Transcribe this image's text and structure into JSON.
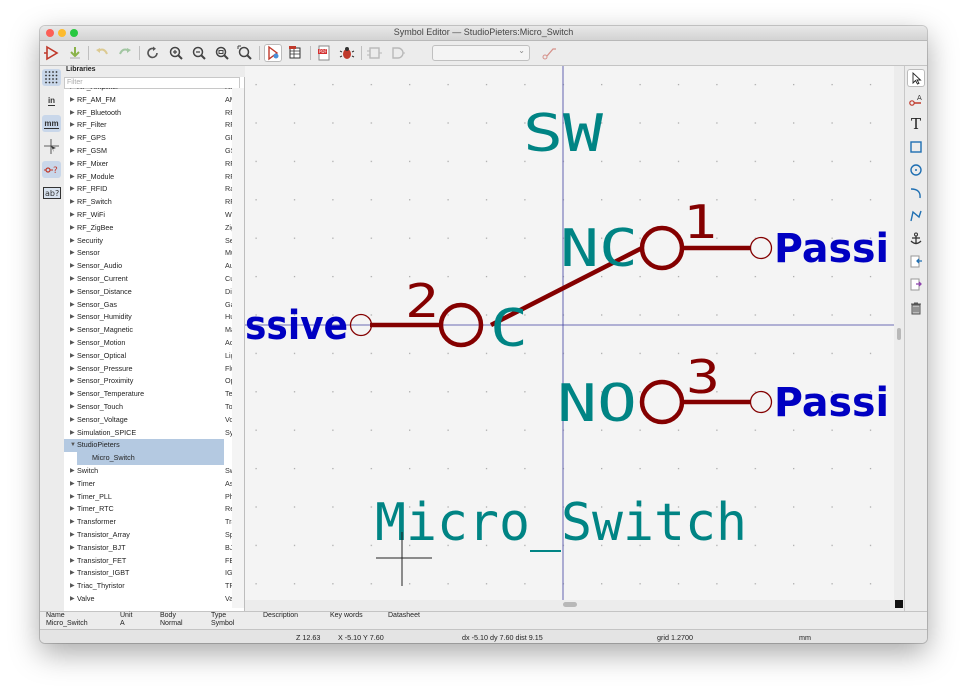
{
  "window": {
    "title": "Symbol Editor — StudioPieters:Micro_Switch"
  },
  "left_toolbar": {
    "inch_label": "in",
    "mm_label": "mm"
  },
  "libraries": {
    "header": "Libraries",
    "filter_placeholder": "Filter",
    "items": [
      {
        "name": "RF_Amplifier",
        "desc": "RF"
      },
      {
        "name": "RF_AM_FM",
        "desc": "AM"
      },
      {
        "name": "RF_Bluetooth",
        "desc": "RF"
      },
      {
        "name": "RF_Filter",
        "desc": "RF"
      },
      {
        "name": "RF_GPS",
        "desc": "GP"
      },
      {
        "name": "RF_GSM",
        "desc": "GS"
      },
      {
        "name": "RF_Mixer",
        "desc": "RF"
      },
      {
        "name": "RF_Module",
        "desc": "RF"
      },
      {
        "name": "RF_RFID",
        "desc": "Ra"
      },
      {
        "name": "RF_Switch",
        "desc": "RF"
      },
      {
        "name": "RF_WiFi",
        "desc": "Wi"
      },
      {
        "name": "RF_ZigBee",
        "desc": "Zig"
      },
      {
        "name": "Security",
        "desc": "Se"
      },
      {
        "name": "Sensor",
        "desc": "Mu"
      },
      {
        "name": "Sensor_Audio",
        "desc": "Au"
      },
      {
        "name": "Sensor_Current",
        "desc": "Cu"
      },
      {
        "name": "Sensor_Distance",
        "desc": "Dis"
      },
      {
        "name": "Sensor_Gas",
        "desc": "Ga"
      },
      {
        "name": "Sensor_Humidity",
        "desc": "Hu"
      },
      {
        "name": "Sensor_Magnetic",
        "desc": "Ma"
      },
      {
        "name": "Sensor_Motion",
        "desc": "Ac"
      },
      {
        "name": "Sensor_Optical",
        "desc": "Lig"
      },
      {
        "name": "Sensor_Pressure",
        "desc": "Flu"
      },
      {
        "name": "Sensor_Proximity",
        "desc": "Op"
      },
      {
        "name": "Sensor_Temperature",
        "desc": "Ter"
      },
      {
        "name": "Sensor_Touch",
        "desc": "Tou"
      },
      {
        "name": "Sensor_Voltage",
        "desc": "Vo"
      },
      {
        "name": "Simulation_SPICE",
        "desc": "Sy"
      },
      {
        "name": "StudioPieters",
        "desc": "",
        "expanded": true,
        "selected": true
      },
      {
        "name": "Micro_Switch",
        "desc": "",
        "child": true,
        "selected": true
      },
      {
        "name": "Switch",
        "desc": "Sw"
      },
      {
        "name": "Timer",
        "desc": "As"
      },
      {
        "name": "Timer_PLL",
        "desc": "Ph"
      },
      {
        "name": "Timer_RTC",
        "desc": "Re"
      },
      {
        "name": "Transformer",
        "desc": "Tra"
      },
      {
        "name": "Transistor_Array",
        "desc": "Sp"
      },
      {
        "name": "Transistor_BJT",
        "desc": "BJ"
      },
      {
        "name": "Transistor_FET",
        "desc": "FE"
      },
      {
        "name": "Transistor_IGBT",
        "desc": "IGE"
      },
      {
        "name": "Triac_Thyristor",
        "desc": "TR"
      },
      {
        "name": "Valve",
        "desc": "Va"
      }
    ]
  },
  "canvas": {
    "reference": "SW",
    "value": "Micro_Switch",
    "pins": [
      {
        "number": "1",
        "name": "NC",
        "type_text": "Passi"
      },
      {
        "number": "2",
        "name": "C",
        "type_text": "ssive"
      },
      {
        "number": "3",
        "name": "NO",
        "type_text": "Passi"
      }
    ],
    "colors": {
      "pin": "#840000",
      "field": "#008484",
      "pin_type": "#0000c2",
      "grid_axis": "#3e3ea0"
    }
  },
  "infobar": {
    "col_name": "Name",
    "col_unit": "Unit",
    "col_body": "Body",
    "col_type": "Type",
    "col_description": "Description",
    "col_keywords": "Key words",
    "col_datasheet": "Datasheet",
    "name": "Micro_Switch",
    "unit": "A",
    "body": "Normal",
    "type": "Symbol"
  },
  "status": {
    "zoom": "Z 12.63",
    "xy": "X -5.10  Y 7.60",
    "delta": "dx -5.10  dy 7.60  dist 9.15",
    "grid": "grid 1.2700",
    "units": "mm"
  }
}
